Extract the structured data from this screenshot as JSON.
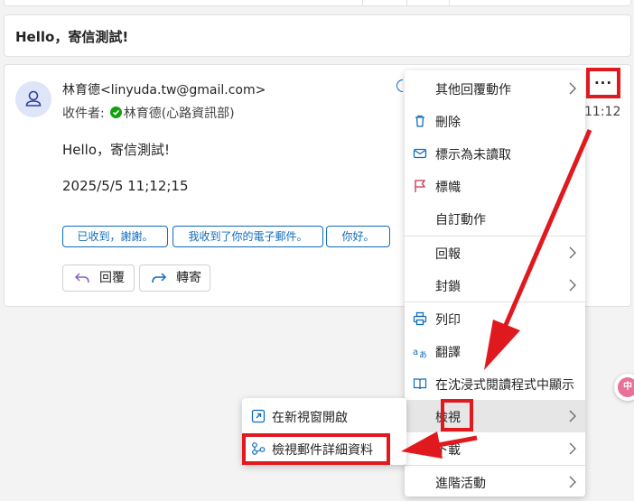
{
  "subject": "Hello，寄信測試!",
  "message": {
    "sender": "林育德<linyuda.tw@gmail.com>",
    "to_label": "收件者:",
    "to_name": "林育德(心路資訊部)",
    "time_fragment": "11:12",
    "body_line1": "Hello，寄信測試!",
    "body_line2": "2025/5/5 11;12;15",
    "suggested_replies": [
      "已收到，謝謝。",
      "我收到了你的電子郵件。",
      "你好。"
    ],
    "reply_button": "回覆",
    "forward_button": "轉寄"
  },
  "more_actions_label": "···",
  "main_menu": {
    "items": [
      {
        "label": "其他回覆動作",
        "icon": "none",
        "submenu": true
      },
      {
        "label": "刪除",
        "icon": "trash-icon",
        "submenu": false
      },
      {
        "label": "標示為未讀取",
        "icon": "envelope-icon",
        "submenu": false
      },
      {
        "label": "標幟",
        "icon": "flag-icon",
        "submenu": false
      },
      {
        "label": "自訂動作",
        "icon": "none",
        "submenu": false
      },
      {
        "label": "回報",
        "icon": "none",
        "submenu": true
      },
      {
        "label": "封鎖",
        "icon": "none",
        "submenu": true
      },
      {
        "label": "列印",
        "icon": "printer-icon",
        "submenu": false
      },
      {
        "label": "翻譯",
        "icon": "translate-icon",
        "submenu": false
      },
      {
        "label": "在沈浸式閱讀程式中顯示",
        "icon": "immersive-reader-icon",
        "submenu": false
      },
      {
        "label": "檢視",
        "icon": "none",
        "submenu": true,
        "highlighted": true
      },
      {
        "label": "下載",
        "icon": "none",
        "submenu": true
      },
      {
        "label": "進階活動",
        "icon": "none",
        "submenu": true
      }
    ]
  },
  "view_submenu": {
    "items": [
      {
        "label": "在新視窗開啟",
        "icon": "open-new-window-icon"
      },
      {
        "label": "檢視郵件詳細資料",
        "icon": "message-details-icon"
      }
    ]
  },
  "floating_badge": "中",
  "colors": {
    "accent": "#0f6cbd",
    "annotation_red": "#e0191f",
    "verified_green": "#13a10e",
    "flag_red": "#c4314b",
    "reply_icon": "#8764b8"
  }
}
